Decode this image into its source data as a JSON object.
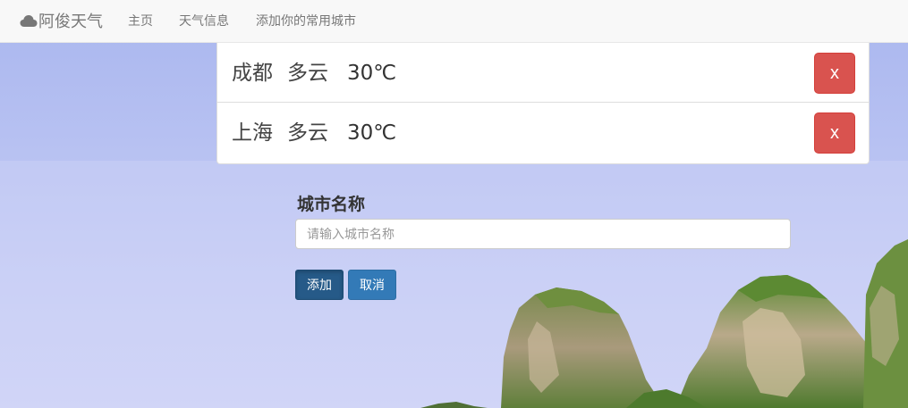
{
  "navbar": {
    "brand": "阿俊天气",
    "brand_icon": "cloud-icon",
    "links": [
      "主页",
      "天气信息",
      "添加你的常用城市"
    ]
  },
  "cities": [
    {
      "name": "成都",
      "weather": "多云",
      "temp": "30℃",
      "delete_label": "x"
    },
    {
      "name": "上海",
      "weather": "多云",
      "temp": "30℃",
      "delete_label": "x"
    }
  ],
  "form": {
    "label": "城市名称",
    "placeholder": "请输入城市名称",
    "value": "",
    "add_label": "添加",
    "cancel_label": "取消"
  },
  "colors": {
    "danger": "#d9534f",
    "primary": "#337ab7",
    "primary_active": "#265a88",
    "navbar_bg": "#f8f8f8"
  }
}
